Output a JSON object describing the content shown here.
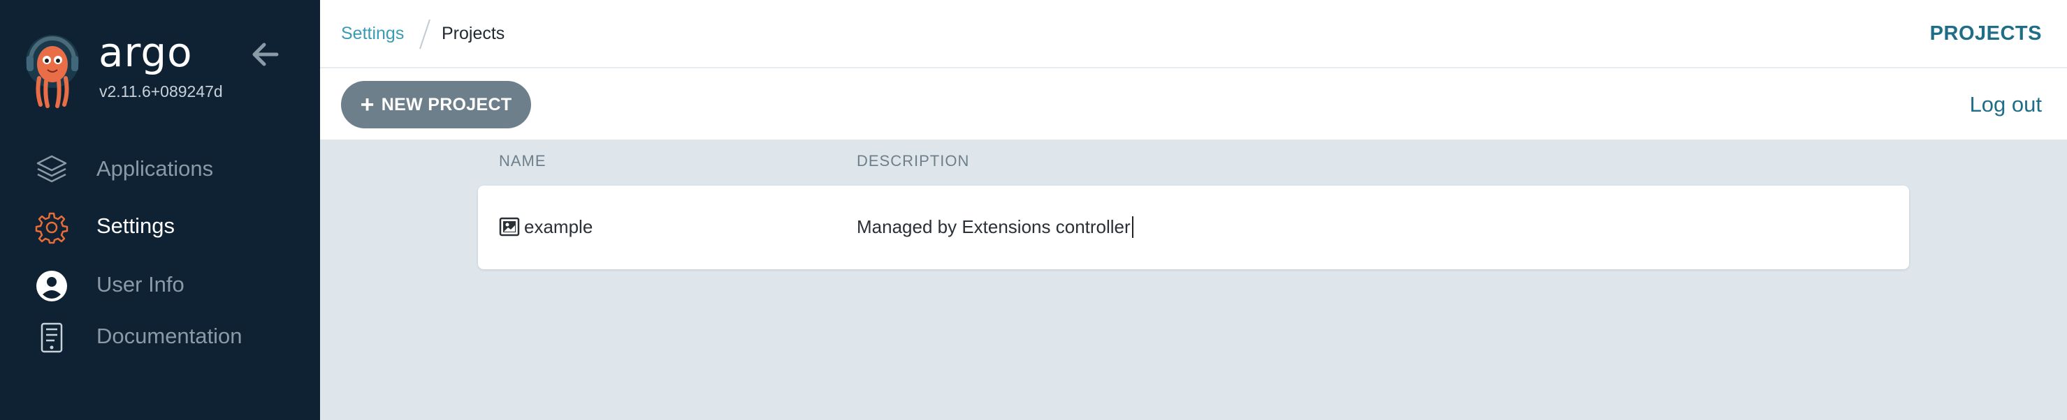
{
  "sidebar": {
    "brand": "argo",
    "version": "v2.11.6+089247d",
    "items": [
      {
        "label": "Applications",
        "icon": "layers-icon",
        "active": false
      },
      {
        "label": "Settings",
        "icon": "gear-icon",
        "active": true
      },
      {
        "label": "User Info",
        "icon": "user-circle-icon",
        "active": false
      },
      {
        "label": "Documentation",
        "icon": "book-icon",
        "active": false
      }
    ]
  },
  "breadcrumb": {
    "parent": "Settings",
    "current": "Projects"
  },
  "header": {
    "title": "PROJECTS"
  },
  "toolbar": {
    "new_project_label": "NEW PROJECT",
    "logout_label": "Log out"
  },
  "table": {
    "columns": [
      "NAME",
      "DESCRIPTION"
    ],
    "rows": [
      {
        "name": "example",
        "description": "Managed by Extensions controller"
      }
    ]
  },
  "colors": {
    "sidebar_bg": "#0f2233",
    "accent": "#1f6d86",
    "link": "#3b9ab4",
    "button_bg": "#6d7f8b",
    "content_bg": "#dee6eb",
    "active_icon": "#e96d36"
  }
}
